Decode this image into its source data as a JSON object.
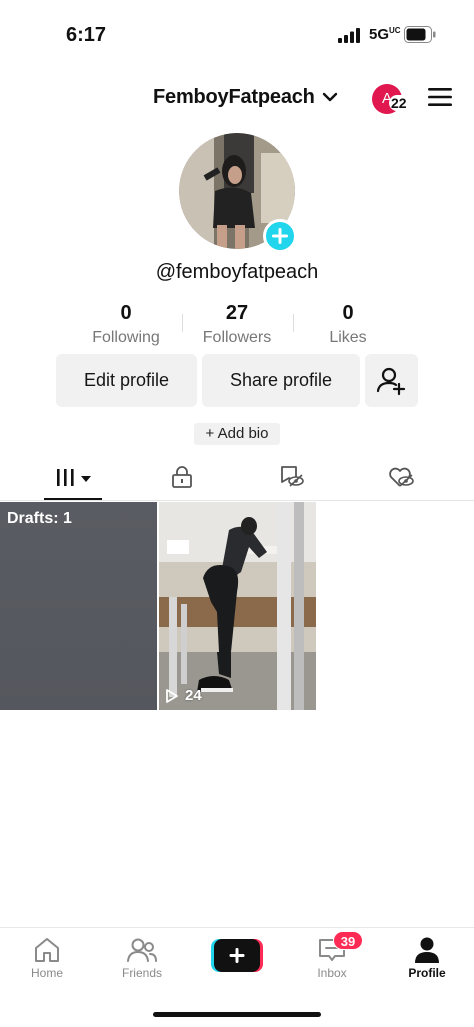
{
  "status_bar": {
    "time": "6:17",
    "network": "5G",
    "network_suffix": "UC"
  },
  "header": {
    "username": "FemboyFatpeach",
    "account_initial": "A",
    "account_badge": "22"
  },
  "profile": {
    "handle": "@femboyfatpeach"
  },
  "stats": [
    {
      "value": "0",
      "label": "Following"
    },
    {
      "value": "27",
      "label": "Followers"
    },
    {
      "value": "0",
      "label": "Likes"
    }
  ],
  "actions": {
    "edit": "Edit profile",
    "share": "Share profile",
    "add_bio": "+ Add bio"
  },
  "tabs": [
    "videos-grid-icon",
    "lock-icon",
    "hidden-bookmark-icon",
    "hidden-heart-icon"
  ],
  "grid": {
    "drafts_label": "Drafts: 1",
    "video_views": "24"
  },
  "nav": {
    "home": "Home",
    "friends": "Friends",
    "inbox": "Inbox",
    "inbox_badge": "39",
    "profile": "Profile"
  },
  "colors": {
    "accent": "#fe2c55",
    "cyan": "#20d5ec",
    "avatar_badge": "#e0184f"
  }
}
